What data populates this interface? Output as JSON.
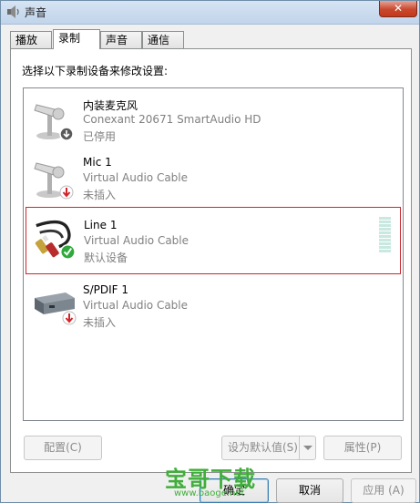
{
  "window": {
    "title": "声音",
    "close_label": "✕"
  },
  "tabs": [
    {
      "label": "播放",
      "active": false
    },
    {
      "label": "录制",
      "active": true
    },
    {
      "label": "声音",
      "active": false
    },
    {
      "label": "通信",
      "active": false
    }
  ],
  "instruction": "选择以下录制设备来修改设置:",
  "devices": [
    {
      "name": "内装麦克风",
      "desc": "Conexant 20671 SmartAudio HD",
      "status": "已停用",
      "icon": "microphone-icon",
      "badge": "disabled-down-arrow-icon",
      "selected": false
    },
    {
      "name": "Mic 1",
      "desc": "Virtual Audio Cable",
      "status": "未插入",
      "icon": "microphone-icon",
      "badge": "unplugged-red-arrow-icon",
      "selected": false
    },
    {
      "name": "Line 1",
      "desc": "Virtual Audio Cable",
      "status": "默认设备",
      "icon": "rca-cable-icon",
      "badge": "default-check-icon",
      "selected": true
    },
    {
      "name": "S/PDIF 1",
      "desc": "Virtual Audio Cable",
      "status": "未插入",
      "icon": "digital-audio-box-icon",
      "badge": "unplugged-red-arrow-icon",
      "selected": false
    }
  ],
  "buttons": {
    "configure": "配置(C)",
    "set_default": "设为默认值(S)",
    "properties": "属性(P)",
    "ok": "确定",
    "cancel": "取消",
    "apply": "应用 (A)"
  },
  "watermark": {
    "text": "宝哥下载",
    "url": "www.baoge.net"
  },
  "colors": {
    "selection_border": "#c8282d",
    "meter": "#c8e8e0",
    "watermark": "#3fae3a"
  }
}
